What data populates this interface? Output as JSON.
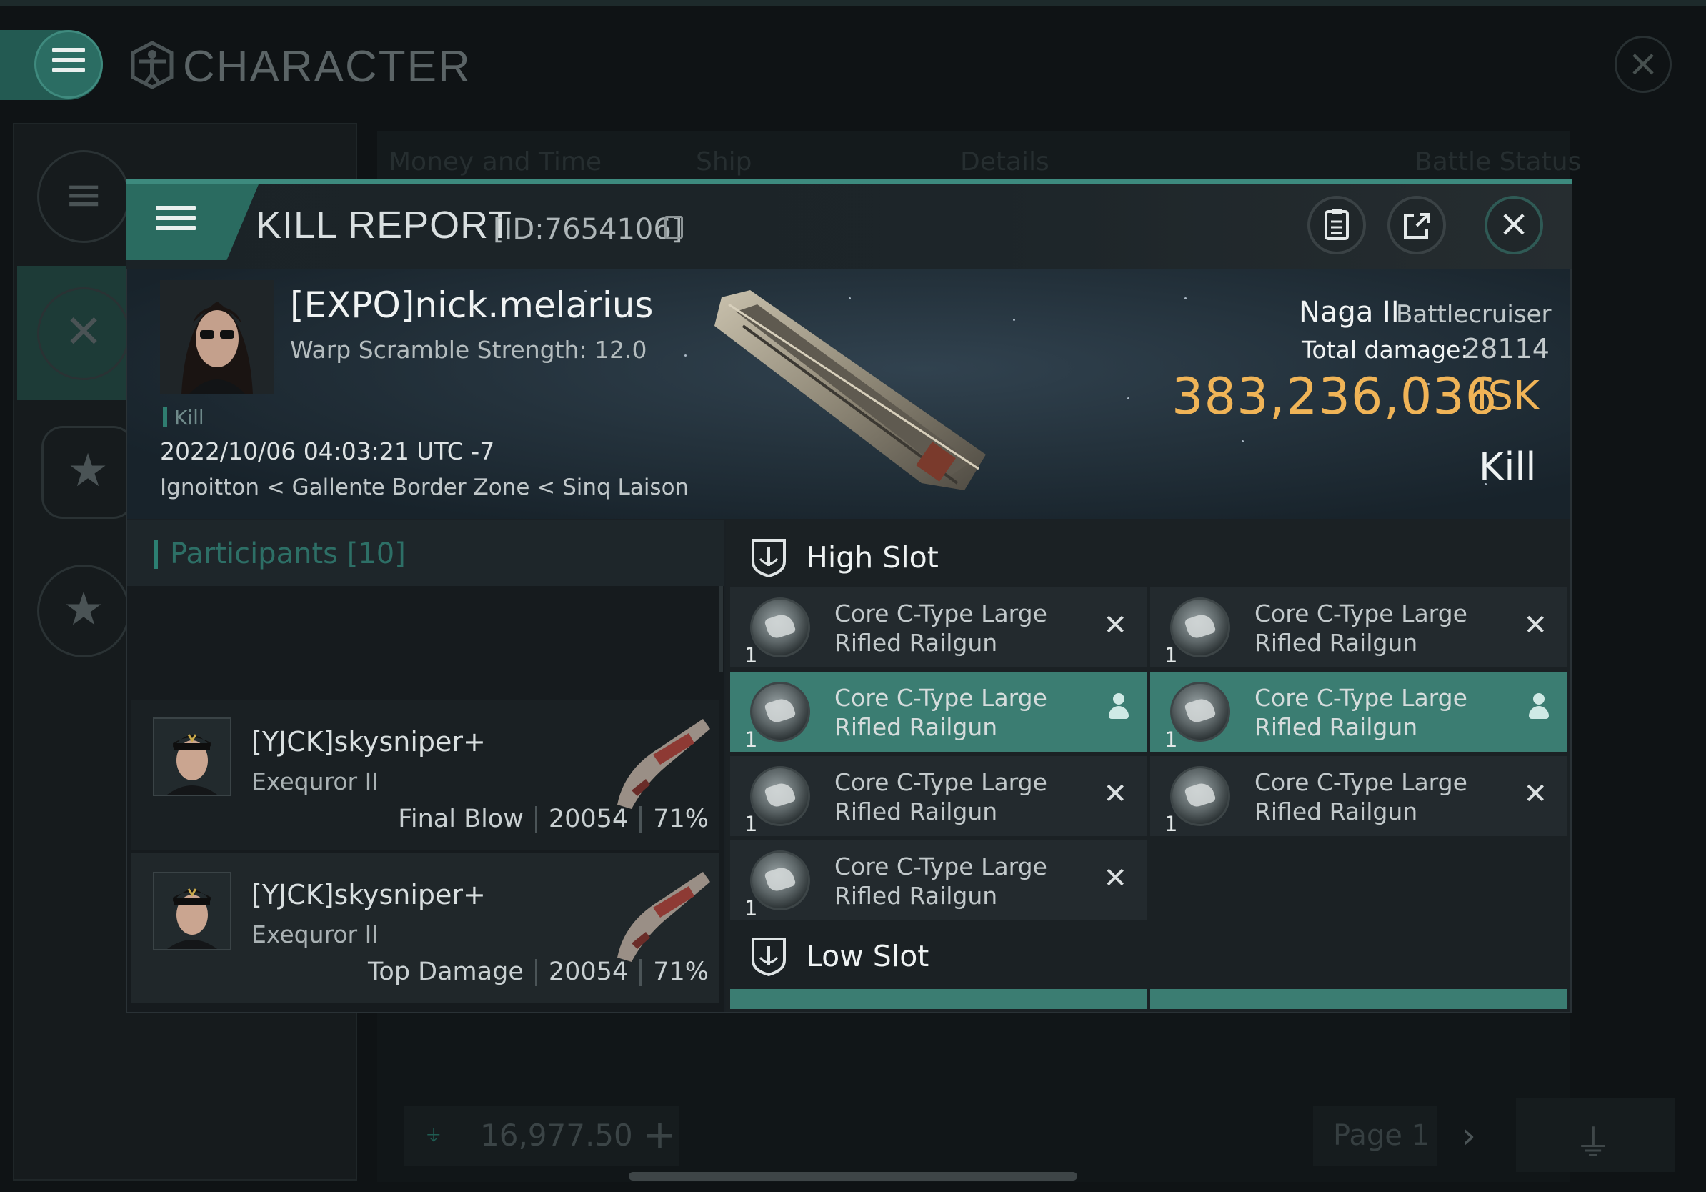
{
  "background": {
    "title": "CHARACTER",
    "tabs": [
      "Money and Time",
      "Ship",
      "Details",
      "Battle Status"
    ],
    "wallet_value": "16,977.50",
    "page_label": "Page 1"
  },
  "kill_report": {
    "title": "KILL REPORT",
    "id_text": "[ID:7654106]",
    "victim": {
      "name": "[EXPO]nick.melarius",
      "warp_scramble": "Warp Scramble Strength: 12.0",
      "tag": "Kill",
      "datetime": "2022/10/06 04:03:21 UTC -7",
      "location": "Ignoitton < Gallente Border Zone < Sinq Laison"
    },
    "ship": {
      "name": "Naga II",
      "class": "Battlecruiser",
      "damage_label": "Total damage:",
      "damage_value": "28114",
      "isk_value": "383,236,036",
      "isk_unit": "ISK",
      "result": "Kill"
    },
    "participants": {
      "label": "Participants",
      "count": "[10]",
      "rows": [
        {
          "name": "[YJCK]skysniper+",
          "ship": "Exequror II",
          "label": "Final Blow",
          "damage": "20054",
          "percent": "71%"
        },
        {
          "name": "[YJCK]skysniper+",
          "ship": "Exequror II",
          "label": "Top Damage",
          "damage": "20054",
          "percent": "71%"
        }
      ]
    },
    "high_slot": {
      "label": "High Slot",
      "items": [
        {
          "line1": "Core C-Type Large",
          "line2": "Rifled Railgun",
          "qty": "1",
          "status": "destroyed"
        },
        {
          "line1": "Core C-Type Large",
          "line2": "Rifled Railgun",
          "qty": "1",
          "status": "destroyed"
        },
        {
          "line1": "Core C-Type Large",
          "line2": "Rifled Railgun",
          "qty": "1",
          "status": "dropped"
        },
        {
          "line1": "Core C-Type Large",
          "line2": "Rifled Railgun",
          "qty": "1",
          "status": "dropped"
        },
        {
          "line1": "Core C-Type Large",
          "line2": "Rifled Railgun",
          "qty": "1",
          "status": "destroyed"
        },
        {
          "line1": "Core C-Type Large",
          "line2": "Rifled Railgun",
          "qty": "1",
          "status": "destroyed"
        },
        {
          "line1": "Core C-Type Large",
          "line2": "Rifled Railgun",
          "qty": "1",
          "status": "destroyed"
        }
      ]
    },
    "low_slot": {
      "label": "Low Slot"
    }
  },
  "icons": {
    "menu": "hamburger-icon",
    "character": "vitruvian-man-icon",
    "copy": "copy-icon",
    "clipboard": "clipboard-icon",
    "share": "external-link-icon",
    "close": "close-icon",
    "destroyed": "x-icon",
    "dropped": "person-icon",
    "slot": "shield-slot-icon"
  },
  "colors": {
    "accent": "#2c7f72",
    "isk": "#f0b457",
    "selected_row": "#3b7d72"
  }
}
